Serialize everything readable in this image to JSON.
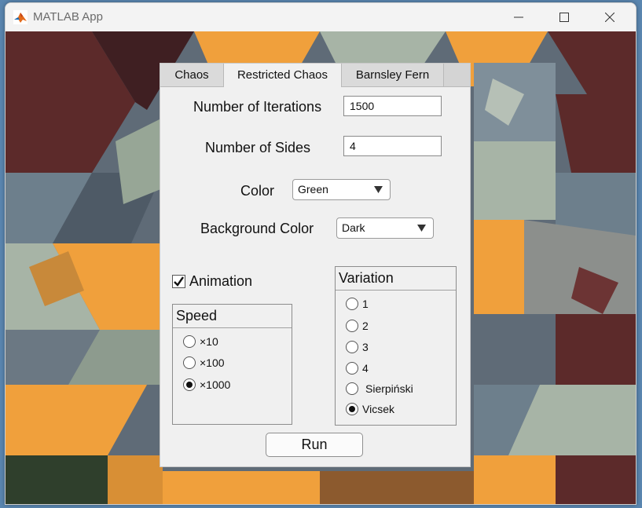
{
  "window": {
    "title": "MATLAB App",
    "controls": [
      "minimize-icon",
      "maximize-icon",
      "close-icon"
    ]
  },
  "tabs": [
    {
      "label": "Chaos",
      "active": false
    },
    {
      "label": "Restricted Chaos",
      "active": true
    },
    {
      "label": "Barnsley Fern",
      "active": false
    }
  ],
  "form": {
    "iterations": {
      "label": "Number of Iterations",
      "value": "1500"
    },
    "sides": {
      "label": "Number of Sides",
      "value": "4"
    },
    "color": {
      "label": "Color",
      "selected": "Green"
    },
    "background_color": {
      "label": "Background Color",
      "selected": "Dark"
    },
    "animation": {
      "label": "Animation",
      "checked": true
    }
  },
  "speed": {
    "title": "Speed",
    "options": [
      {
        "label": "×10",
        "checked": false
      },
      {
        "label": "×100",
        "checked": false
      },
      {
        "label": "×1000",
        "checked": true
      }
    ]
  },
  "variation": {
    "title": "Variation",
    "options": [
      {
        "label": "1",
        "checked": false
      },
      {
        "label": "2",
        "checked": false
      },
      {
        "label": "3",
        "checked": false
      },
      {
        "label": "4",
        "checked": false
      },
      {
        "label": "Sierpiński",
        "checked": false
      },
      {
        "label": "Vicsek",
        "checked": true
      }
    ]
  },
  "run_button": {
    "label": "Run"
  },
  "colors": {
    "orange": "#f0a03c",
    "maroon": "#5c2a2a",
    "slate": "#6d7f8c",
    "sage": "#a7b4a6",
    "panel": "#f0f0f0"
  }
}
